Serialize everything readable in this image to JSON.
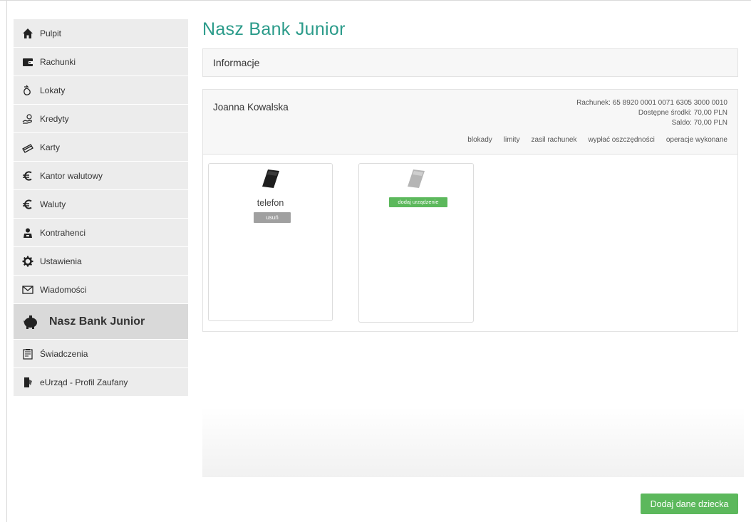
{
  "sidebar": {
    "items": [
      {
        "label": "Pulpit",
        "icon": "home-icon"
      },
      {
        "label": "Rachunki",
        "icon": "wallet-icon"
      },
      {
        "label": "Lokaty",
        "icon": "deposit-icon"
      },
      {
        "label": "Kredyty",
        "icon": "credit-hand-icon"
      },
      {
        "label": "Karty",
        "icon": "card-icon"
      },
      {
        "label": "Kantor walutowy",
        "icon": "euro-icon"
      },
      {
        "label": "Waluty",
        "icon": "euro-icon"
      },
      {
        "label": "Kontrahenci",
        "icon": "contacts-icon"
      },
      {
        "label": "Ustawienia",
        "icon": "gear-icon"
      },
      {
        "label": "Wiadomości",
        "icon": "envelope-icon"
      },
      {
        "label": "Nasz Bank Junior",
        "icon": "piggy-bank-icon",
        "active": true
      },
      {
        "label": "Świadczenia",
        "icon": "benefits-icon"
      },
      {
        "label": "eUrząd - Profil Zaufany",
        "icon": "eurzad-icon"
      }
    ]
  },
  "main": {
    "title": "Nasz Bank Junior",
    "info_label": "Informacje",
    "account": {
      "holder": "Joanna Kowalska",
      "number_line": "Rachunek: 65 8920 0001 0071 6305 3000 0010",
      "available_line": "Dostępne środki: 70,00 PLN",
      "balance_line": "Saldo: 70,00 PLN",
      "links": [
        "blokady",
        "limity",
        "zasil rachunek",
        "wypłać oszczędności",
        "operacje wykonane"
      ]
    },
    "devices": {
      "device_name": "telefon",
      "remove_label": "usuń",
      "add_device_label": "dodaj urządzenie"
    },
    "add_child_label": "Dodaj dane dziecka"
  },
  "colors": {
    "accent_title": "#2b9b8a",
    "button_green": "#5cb85c",
    "sidebar_bg": "#ececec",
    "sidebar_active_bg": "#d9d9d9"
  }
}
